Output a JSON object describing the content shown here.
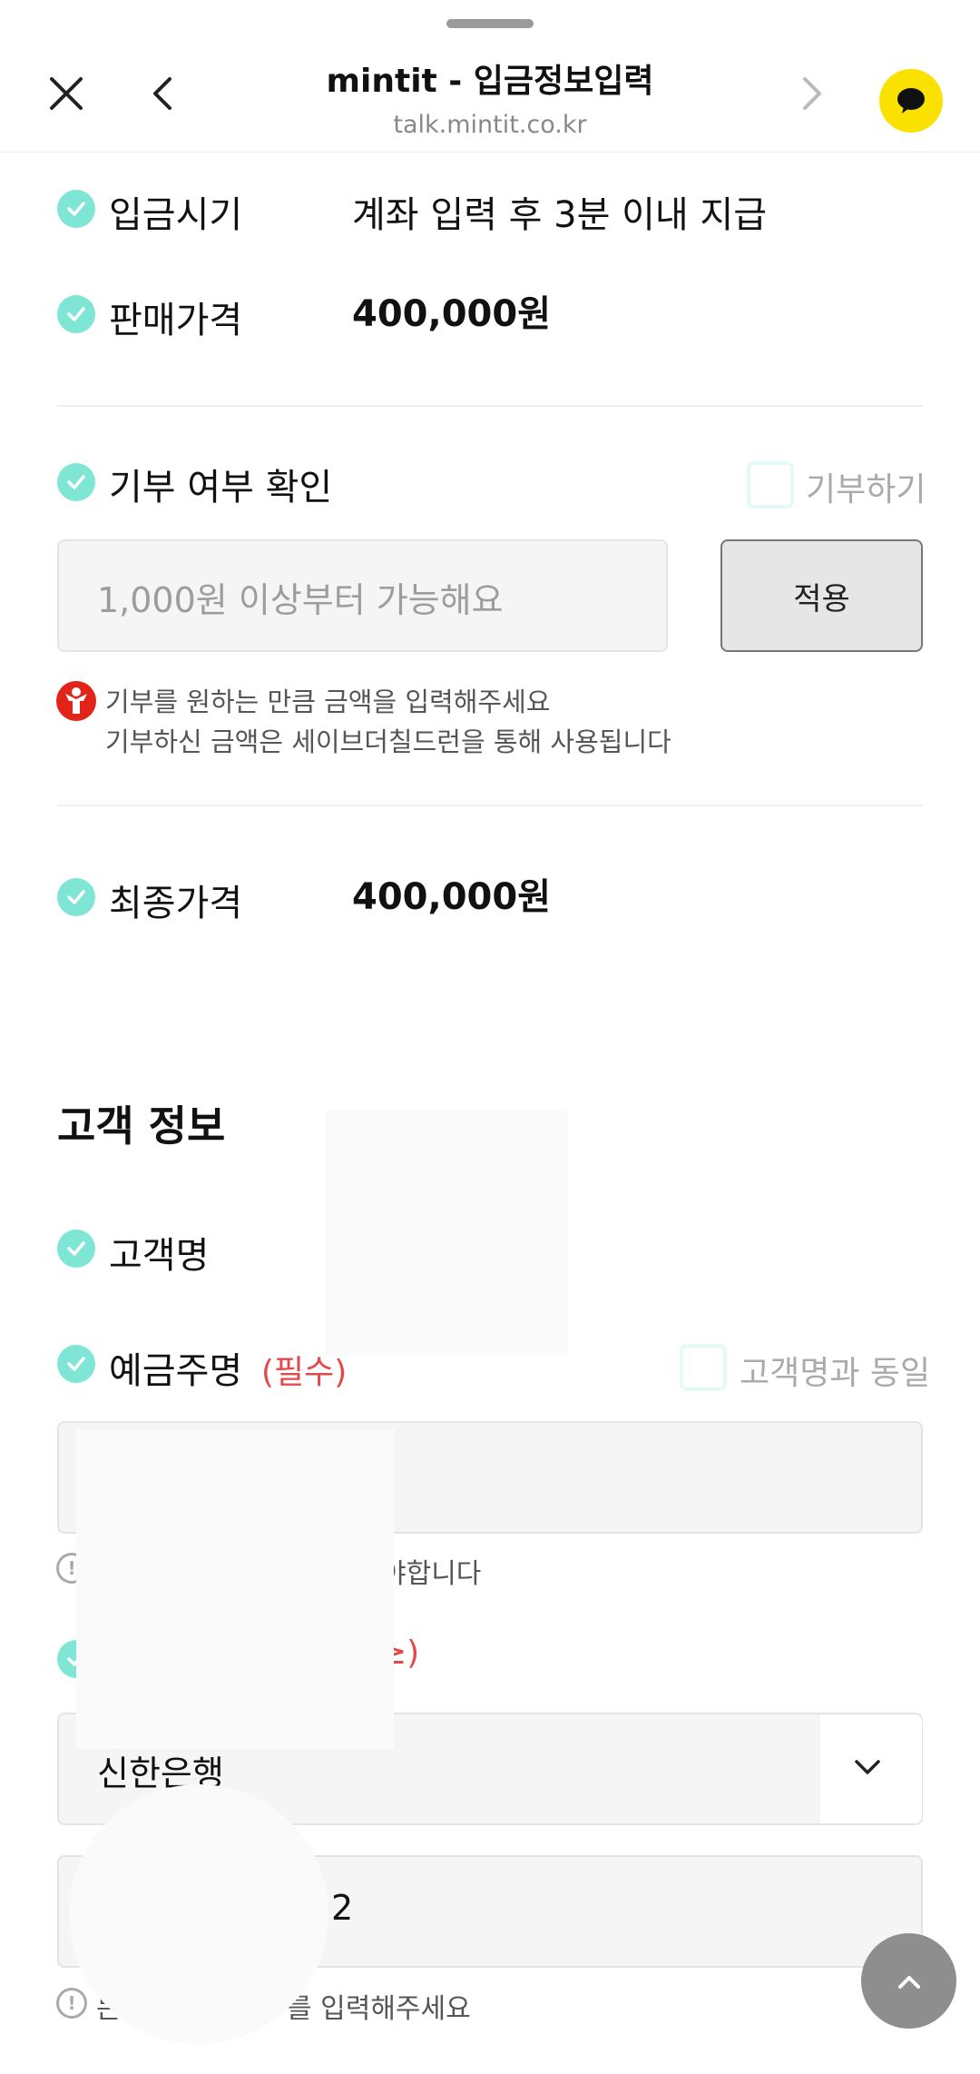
{
  "header": {
    "title": "mintit - 입금정보입력",
    "url": "talk.mintit.co.kr"
  },
  "payment": {
    "timing_label": "입금시기",
    "timing_value": "계좌 입력 후 3분 이내 지급",
    "sale_price_label": "판매가격",
    "sale_price_value": "400,000원"
  },
  "donation": {
    "label": "기부 여부 확인",
    "checkbox_label": "기부하기",
    "amount_placeholder": "1,000원 이상부터 가능해요",
    "apply_label": "적용",
    "note_line1": "기부를 원하는 만큼 금액을 입력해주세요",
    "note_line2": "기부하신 금액은 세이브더칠드런을 통해 사용됩니다"
  },
  "final": {
    "label": "최종가격",
    "value": "400,000원"
  },
  "customer": {
    "section_title": "고객 정보",
    "name_label": "고객명",
    "holder_label": "예금주명",
    "holder_required": "(필수)",
    "same_as_customer_label": "고객명과 동일",
    "holder_hint_partial": "야합니다",
    "bank_required_partial": "≥)",
    "bank_selected": "신한은행",
    "account_partial": "2",
    "account_hint_prefix": "는",
    "account_hint_suffix": "를 입력해주세요"
  },
  "colors": {
    "accent_mint": "#7fe6d6",
    "required_red": "#e24a4a",
    "kakao_yellow": "#fae100"
  },
  "icons": {
    "close": "close-icon",
    "back": "chevron-left-icon",
    "forward": "chevron-right-icon",
    "kakao": "kakao-talk-icon",
    "check": "check-icon",
    "chevron_down": "chevron-down-icon",
    "scroll_top": "chevron-up-icon",
    "info": "exclamation-circle-icon",
    "donation_logo": "save-the-children-logo"
  }
}
